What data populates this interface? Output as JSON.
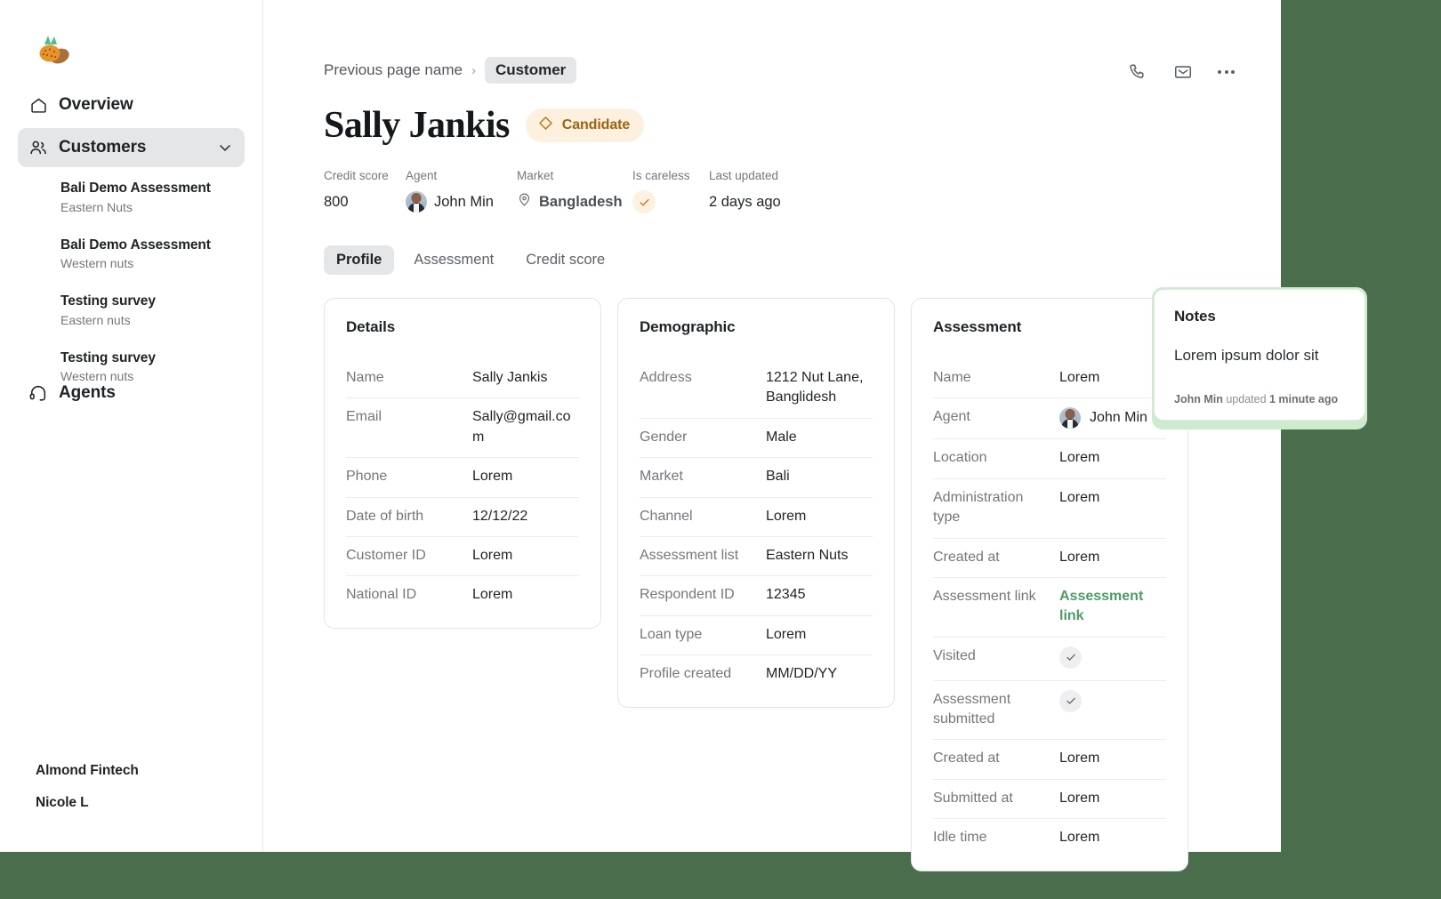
{
  "theme": {
    "page_background": "#4a6e4c",
    "accent_green": "#4f9a66",
    "badge_amber": "#9a6512",
    "badge_amber_bg": "#fdf0de",
    "halo_green": "#cdeccd"
  },
  "sidebar": {
    "logo_name": "almond-nuts-logo",
    "items": [
      {
        "label": "Overview",
        "icon": "home-icon",
        "active": false
      },
      {
        "label": "Customers",
        "icon": "users-icon",
        "active": true,
        "chevron": "chevron-down-icon"
      }
    ],
    "sub_items": [
      {
        "title": "Bali Demo Assessment",
        "subtitle": "Eastern Nuts"
      },
      {
        "title": "Bali Demo Assessment",
        "subtitle": "Western nuts"
      },
      {
        "title": "Testing survey",
        "subtitle": "Eastern nuts"
      },
      {
        "title": "Testing survey",
        "subtitle": "Western nuts"
      }
    ],
    "agents": {
      "label": "Agents",
      "icon": "headset-icon"
    },
    "footer": {
      "org": "Almond Fintech",
      "user": "Nicole L"
    }
  },
  "topbar": {
    "breadcrumb": {
      "previous": "Previous page name",
      "separator": "›",
      "current": "Customer"
    },
    "actions": [
      {
        "name": "phone-icon",
        "label": "Call"
      },
      {
        "name": "mail-icon",
        "label": "Email"
      },
      {
        "name": "more-options-icon",
        "label": "More"
      }
    ]
  },
  "header": {
    "title": "Sally Jankis",
    "badge": {
      "label": "Candidate",
      "icon": "diamond-icon"
    },
    "meta": [
      {
        "label": "Credit score",
        "value": "800",
        "type": "text"
      },
      {
        "label": "Agent",
        "value": "John Min",
        "type": "avatar"
      },
      {
        "label": "Market",
        "value": "Bangladesh",
        "type": "location"
      },
      {
        "label": "Is careless",
        "value": "",
        "type": "check"
      },
      {
        "label": "Last updated",
        "value": "2 days ago",
        "type": "text"
      }
    ]
  },
  "tabs": [
    {
      "label": "Profile",
      "active": true
    },
    {
      "label": "Assessment",
      "active": false
    },
    {
      "label": "Credit score",
      "active": false
    }
  ],
  "cards": [
    {
      "title": "Details",
      "rows": [
        {
          "label": "Name",
          "value": "Sally Jankis",
          "type": "text"
        },
        {
          "label": "Email",
          "value": "Sally@gmail.com",
          "type": "text"
        },
        {
          "label": "Phone",
          "value": "Lorem",
          "type": "text"
        },
        {
          "label": "Date of birth",
          "value": "12/12/22",
          "type": "text"
        },
        {
          "label": "Customer ID",
          "value": "Lorem",
          "type": "text"
        },
        {
          "label": "National ID",
          "value": "Lorem",
          "type": "text"
        }
      ]
    },
    {
      "title": "Demographic",
      "rows": [
        {
          "label": "Address",
          "value": "1212 Nut Lane, Banglidesh",
          "type": "text"
        },
        {
          "label": "Gender",
          "value": "Male",
          "type": "text"
        },
        {
          "label": "Market",
          "value": "Bali",
          "type": "text"
        },
        {
          "label": "Channel",
          "value": "Lorem",
          "type": "text"
        },
        {
          "label": "Assessment list",
          "value": "Eastern Nuts",
          "type": "text"
        },
        {
          "label": "Respondent ID",
          "value": "12345",
          "type": "text"
        },
        {
          "label": "Loan type",
          "value": "Lorem",
          "type": "text"
        },
        {
          "label": "Profile created",
          "value": "MM/DD/YY",
          "type": "text"
        }
      ]
    },
    {
      "title": "Assessment",
      "rows": [
        {
          "label": "Name",
          "value": "Lorem",
          "type": "text"
        },
        {
          "label": "Agent",
          "value": "John Min",
          "type": "avatar"
        },
        {
          "label": "Location",
          "value": "Lorem",
          "type": "text"
        },
        {
          "label": "Administration type",
          "value": "Lorem",
          "type": "text"
        },
        {
          "label": "Created at",
          "value": "Lorem",
          "type": "text"
        },
        {
          "label": "Assessment link",
          "value": "Assessment link",
          "type": "link"
        },
        {
          "label": "Visited",
          "value": "",
          "type": "check"
        },
        {
          "label": "Assessment submitted",
          "value": "",
          "type": "check"
        },
        {
          "label": "Created at",
          "value": "Lorem",
          "type": "text"
        },
        {
          "label": "Submitted at",
          "value": "Lorem",
          "type": "text"
        },
        {
          "label": "Idle time",
          "value": "Lorem",
          "type": "text"
        }
      ]
    }
  ],
  "notes": {
    "title": "Notes",
    "body": "Lorem ipsum dolor sit",
    "footer_author": "John Min",
    "footer_middle": " updated ",
    "footer_time": "1 minute ago"
  }
}
